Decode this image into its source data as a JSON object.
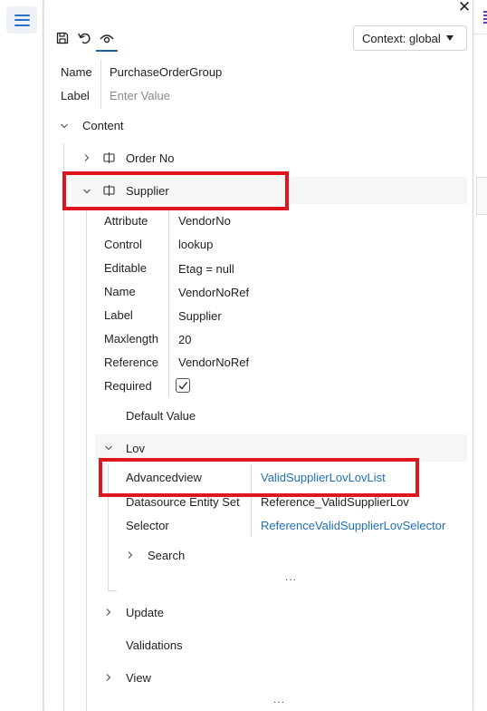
{
  "window": {
    "close_glyph": "✕",
    "menu_icon": "hamburger-icon"
  },
  "toolbar": {
    "save_icon": "save-icon",
    "undo_icon": "undo-icon",
    "preview_icon": "eye-icon",
    "context_label": "Context: global"
  },
  "header_fields": {
    "name_label": "Name",
    "name_value": "PurchaseOrderGroup",
    "label_label": "Label",
    "label_placeholder": "Enter Value"
  },
  "tree": {
    "content": "Content",
    "order_no": "Order No",
    "supplier": "Supplier",
    "supplier_props": [
      {
        "label": "Attribute",
        "value": "VendorNo"
      },
      {
        "label": "Control",
        "value": "lookup"
      },
      {
        "label": "Editable",
        "value": "Etag = null"
      },
      {
        "label": "Name",
        "value": "VendorNoRef"
      },
      {
        "label": "Label",
        "value": "Supplier"
      },
      {
        "label": "Maxlength",
        "value": "20"
      },
      {
        "label": "Reference",
        "value": "VendorNoRef"
      },
      {
        "label": "Required",
        "value": ""
      }
    ],
    "required_checked": true,
    "default_value": "Default Value",
    "lov": "Lov",
    "lov_props": [
      {
        "label": "Advancedview",
        "value": "ValidSupplierLovLovList"
      },
      {
        "label": "Datasource Entity Set",
        "value": "Reference_ValidSupplierLov"
      },
      {
        "label": "Selector",
        "value": "ReferenceValidSupplierLovSelector"
      }
    ],
    "search": "Search",
    "ellipsis": "...",
    "update": "Update",
    "validations": "Validations",
    "view": "View"
  },
  "colors": {
    "highlight": "#e0161e",
    "link": "#1f6fb8",
    "accent": "#1f5fa8"
  }
}
